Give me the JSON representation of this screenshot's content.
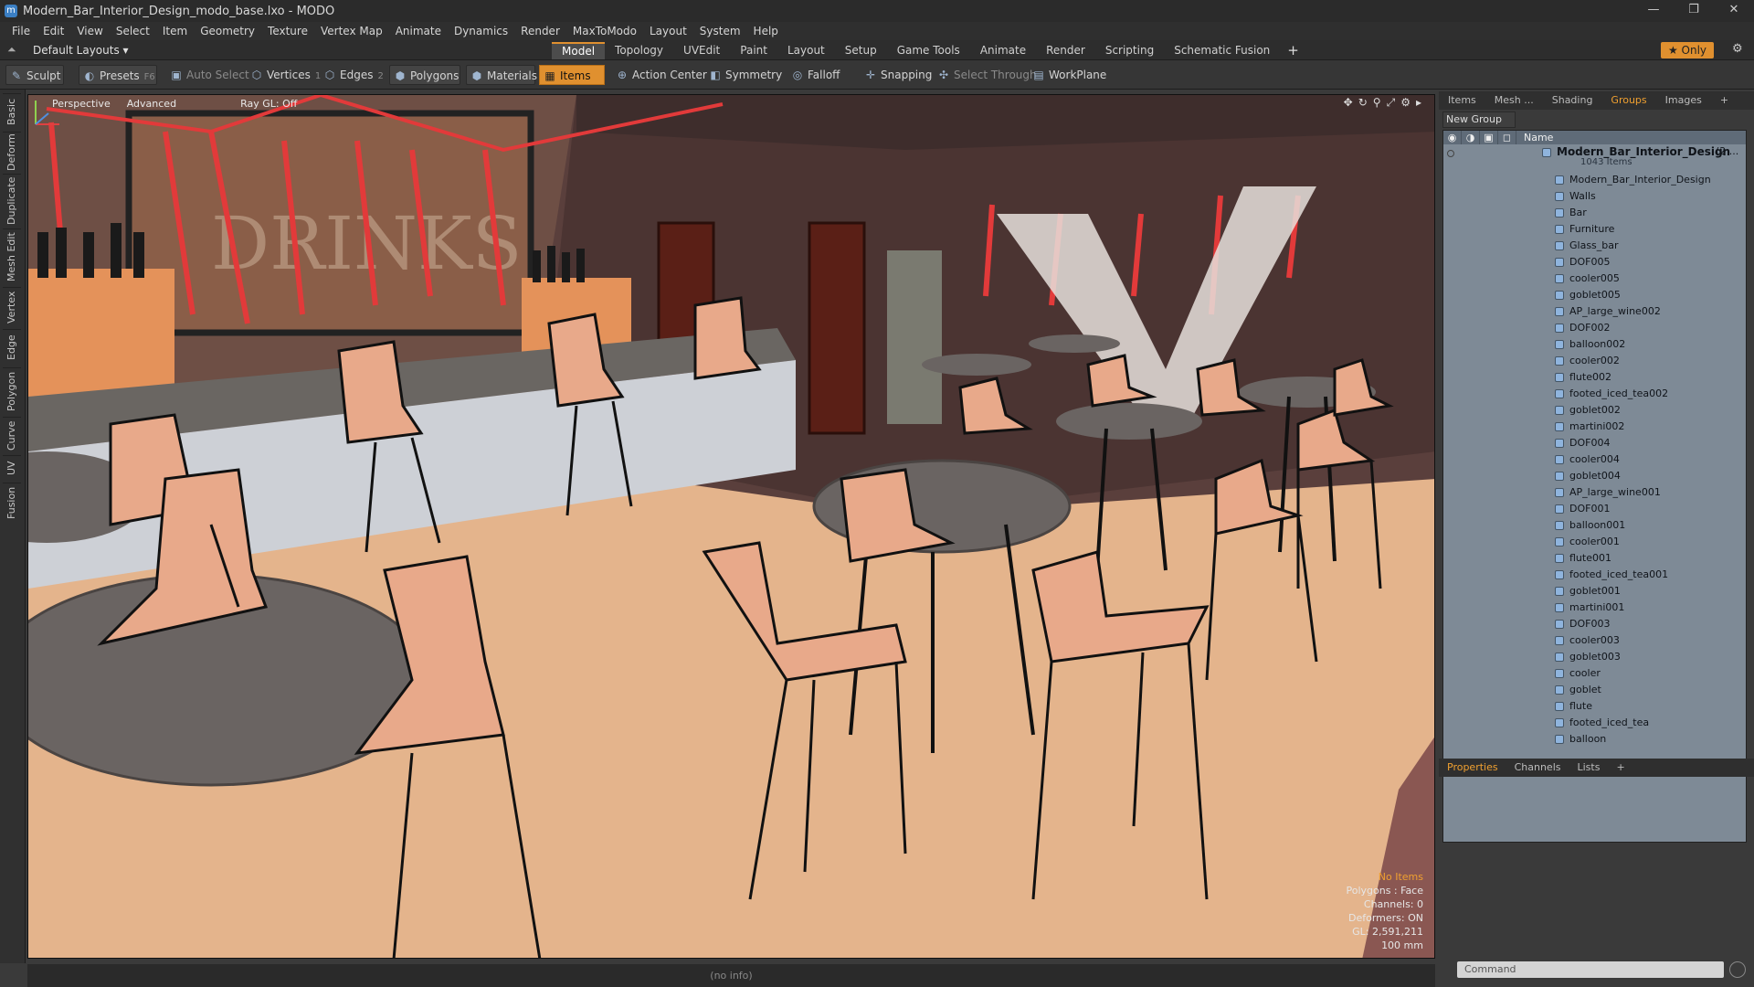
{
  "window": {
    "title": "Modern_Bar_Interior_Design_modo_base.lxo - MODO",
    "minimize": "—",
    "maximize": "❐",
    "close": "✕"
  },
  "menu": [
    "File",
    "Edit",
    "View",
    "Select",
    "Item",
    "Geometry",
    "Texture",
    "Vertex Map",
    "Animate",
    "Dynamics",
    "Render",
    "MaxToModo",
    "Layout",
    "System",
    "Help"
  ],
  "layoutbar": {
    "layouts": "Default Layouts ▾",
    "only": "★ Only"
  },
  "tabs": [
    "Model",
    "Topology",
    "UVEdit",
    "Paint",
    "Layout",
    "Setup",
    "Game Tools",
    "Animate",
    "Render",
    "Scripting",
    "Schematic Fusion"
  ],
  "active_tab": "Model",
  "toolbar": {
    "sculpt": "Sculpt",
    "presets": "Presets",
    "presets_key": "F6",
    "auto_select": "Auto Select",
    "vertices": "Vertices",
    "vertices_key": "1",
    "edges": "Edges",
    "edges_key": "2",
    "polygons": "Polygons",
    "materials": "Materials",
    "items": "Items",
    "action_center": "Action Center",
    "symmetry": "Symmetry",
    "falloff": "Falloff",
    "snapping": "Snapping",
    "select_through": "Select Through",
    "workplane": "WorkPlane"
  },
  "left_tabs": [
    "Basic",
    "Deform",
    "Duplicate",
    "Mesh Edit",
    "Vertex",
    "Edge",
    "Polygon",
    "Curve",
    "UV",
    "Fusion"
  ],
  "viewport": {
    "projection": "Perspective",
    "shading": "Advanced",
    "raygl": "Ray GL: Off",
    "sign_text": "DRINKS",
    "info": {
      "no_items": "No Items",
      "polygons": "Polygons : Face",
      "channels": "Channels: 0",
      "deformers": "Deformers: ON",
      "gl": "GL: 2,591,211",
      "scale": "100 mm"
    }
  },
  "status": "(no info)",
  "right_tabs": [
    "Items",
    "Mesh ...",
    "Shading",
    "Groups",
    "Images"
  ],
  "active_right_tab": "Groups",
  "groups": {
    "new_group": "New Group",
    "name_header": "Name",
    "root": {
      "name": "Modern_Bar_Interior_Design",
      "suffix": "(2 ...",
      "count": "1043 Items"
    },
    "items": [
      "Modern_Bar_Interior_Design",
      "Walls",
      "Bar",
      "Furniture",
      "Glass_bar",
      "DOF005",
      "cooler005",
      "goblet005",
      "AP_large_wine002",
      "DOF002",
      "balloon002",
      "cooler002",
      "flute002",
      "footed_iced_tea002",
      "goblet002",
      "martini002",
      "DOF004",
      "cooler004",
      "goblet004",
      "AP_large_wine001",
      "DOF001",
      "balloon001",
      "cooler001",
      "flute001",
      "footed_iced_tea001",
      "goblet001",
      "martini001",
      "DOF003",
      "cooler003",
      "goblet003",
      "cooler",
      "goblet",
      "flute",
      "footed_iced_tea",
      "balloon"
    ]
  },
  "properties_tabs": [
    "Properties",
    "Channels",
    "Lists"
  ],
  "command_placeholder": "Command",
  "colors": {
    "accent": "#e0902f",
    "chair": "#e8a98a",
    "floor": "#e4b48c",
    "wall": "#4b3432",
    "table": "#6a6462"
  }
}
